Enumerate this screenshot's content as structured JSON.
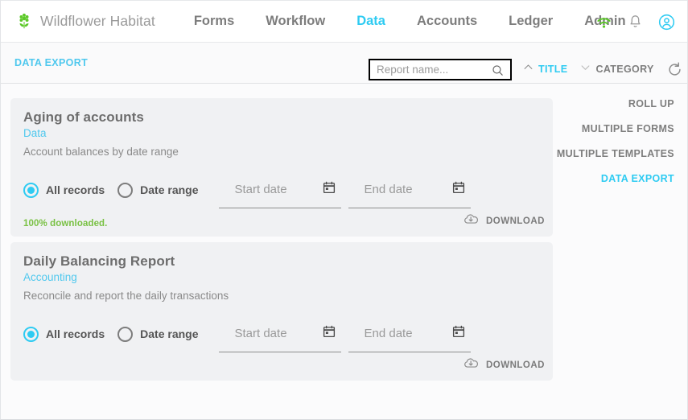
{
  "brand": {
    "name": "Wildflower Habitat",
    "logo_icon": "flower-icon",
    "logo_color": "#5cc928"
  },
  "nav": {
    "links": [
      {
        "label": "Forms",
        "active": false
      },
      {
        "label": "Workflow",
        "active": false
      },
      {
        "label": "Data",
        "active": true
      },
      {
        "label": "Accounts",
        "active": false
      },
      {
        "label": "Ledger",
        "active": false
      },
      {
        "label": "Admin",
        "active": false
      }
    ],
    "icons": [
      {
        "name": "wifi-icon",
        "color": "#5cc928"
      },
      {
        "name": "bell-icon",
        "color": "#9a9a9a"
      },
      {
        "name": "account-icon",
        "color": "#2ecbf2"
      }
    ]
  },
  "toolbar": {
    "title": "DATA EXPORT",
    "search": {
      "value": "",
      "placeholder": "Report name...",
      "icon": "search-icon"
    },
    "sorts": [
      {
        "label": "TITLE",
        "direction": "asc",
        "icon": "chevron-up-icon",
        "active": true
      },
      {
        "label": "CATEGORY",
        "direction": "desc",
        "icon": "chevron-down-icon",
        "active": false
      }
    ],
    "refresh": {
      "label": "",
      "icon": "refresh-icon"
    }
  },
  "sidemenu": {
    "items": [
      {
        "label": "ROLL UP",
        "active": false
      },
      {
        "label": "MULTIPLE FORMS",
        "active": false
      },
      {
        "label": "MULTIPLE TEMPLATES",
        "active": false
      },
      {
        "label": "DATA EXPORT",
        "active": true
      }
    ]
  },
  "accent": {
    "cyan": "#2ecbf2",
    "cyan_light": "#4fc8ee",
    "green": "#79c143",
    "gray": "#7e7e7e"
  },
  "cards": [
    {
      "title": "Aging of accounts",
      "category": "Data",
      "description": "Account balances by date range",
      "radios": [
        {
          "label": "All records",
          "checked": true
        },
        {
          "label": "Date range",
          "checked": false
        }
      ],
      "start_date": {
        "value": "",
        "placeholder": "Start date",
        "icon": "calendar-icon"
      },
      "end_date": {
        "value": "",
        "placeholder": "End date",
        "icon": "calendar-icon"
      },
      "status": "100% downloaded.",
      "download_label": "DOWNLOAD",
      "download_icon": "cloud-download-icon"
    },
    {
      "title": "Daily Balancing Report",
      "category": "Accounting",
      "description": "Reconcile and report the daily transactions",
      "radios": [
        {
          "label": "All records",
          "checked": true
        },
        {
          "label": "Date range",
          "checked": false
        }
      ],
      "start_date": {
        "value": "",
        "placeholder": "Start date",
        "icon": "calendar-icon"
      },
      "end_date": {
        "value": "",
        "placeholder": "End date",
        "icon": "calendar-icon"
      },
      "status": "",
      "download_label": "DOWNLOAD",
      "download_icon": "cloud-download-icon"
    }
  ]
}
